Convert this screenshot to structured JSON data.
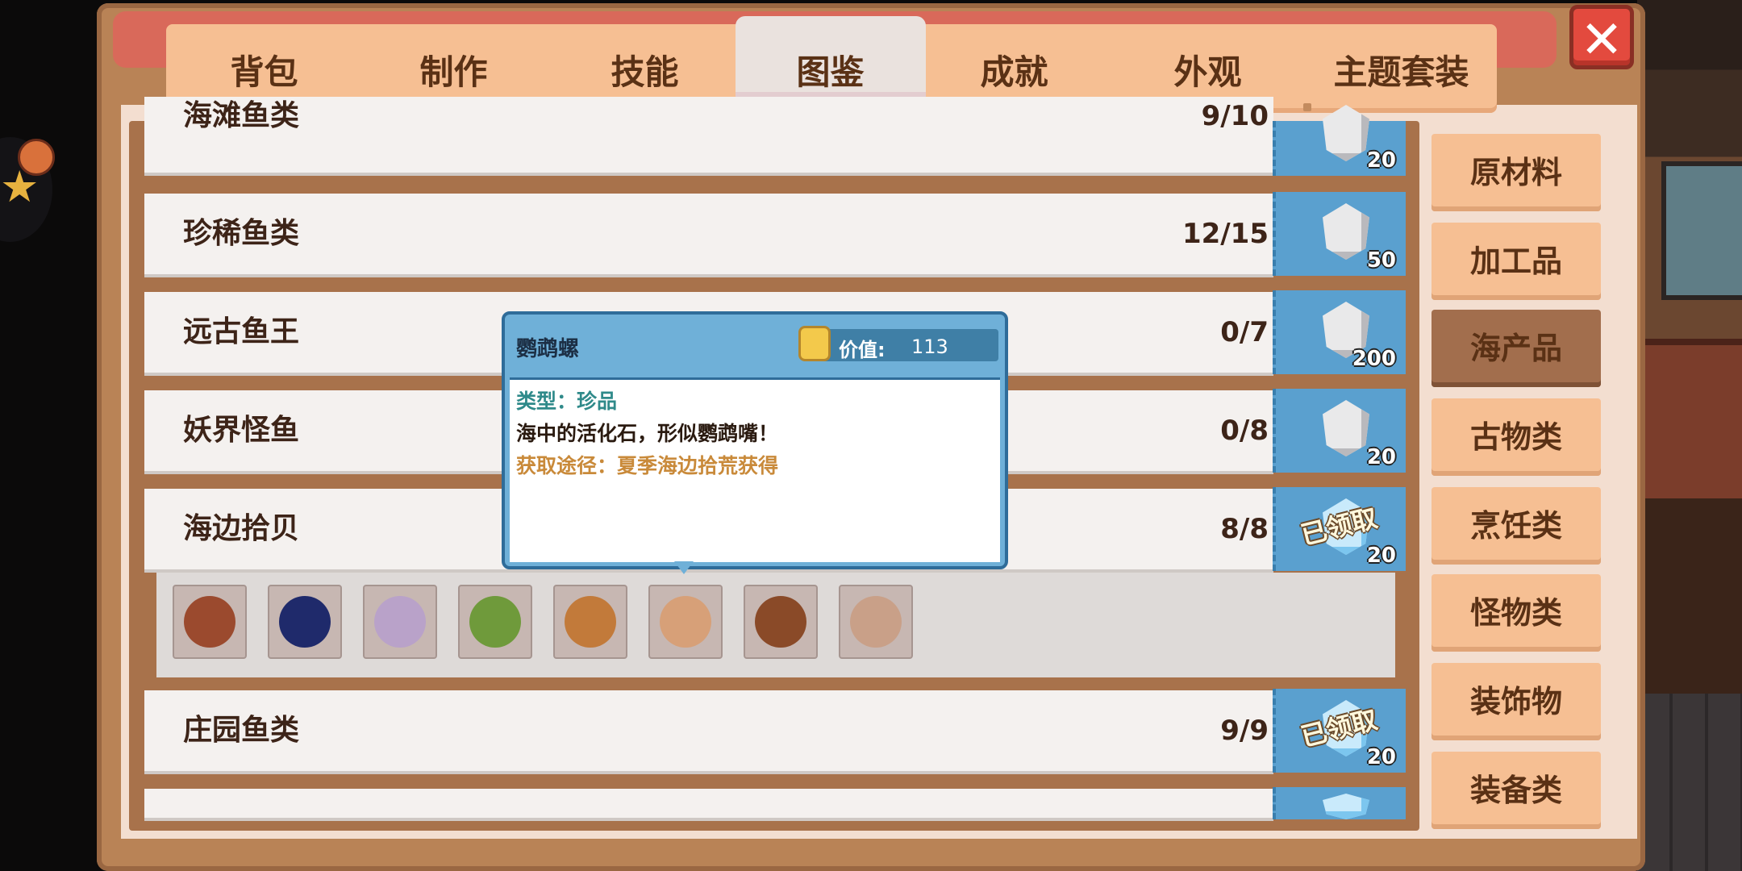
{
  "tabs": [
    "背包",
    "制作",
    "技能",
    "图鉴",
    "成就",
    "外观",
    "主题套装"
  ],
  "active_tab": "图鉴",
  "close_label": "✕",
  "collection_rows": [
    {
      "name": "海滩鱼类",
      "count": "9/10",
      "reward": "20",
      "claimed": false
    },
    {
      "name": "珍稀鱼类",
      "count": "12/15",
      "reward": "50",
      "claimed": false
    },
    {
      "name": "远古鱼王",
      "count": "0/7",
      "reward": "200",
      "claimed": false
    },
    {
      "name": "妖界怪鱼",
      "count": "0/8",
      "reward": "20",
      "claimed": false
    },
    {
      "name": "海边拾贝",
      "count": "8/8",
      "reward": "20",
      "claimed": true
    },
    {
      "name": "庄园鱼类",
      "count": "9/9",
      "reward": "20",
      "claimed": true
    }
  ],
  "claimed_label": "已领取",
  "categories": [
    "原材料",
    "加工品",
    "海产品",
    "古物类",
    "烹饪类",
    "怪物类",
    "装饰物",
    "装备类"
  ],
  "active_category": "海产品",
  "tooltip": {
    "title": "鹦鹉螺",
    "value_label": "价值:",
    "value": "113",
    "type": "类型：珍品",
    "description": "海中的活化石，形似鹦鹉嘴！",
    "source": "获取途径：夏季海边拾荒获得"
  },
  "item_icons": [
    "shell-spiral-icon",
    "sea-urchin-icon",
    "pearl-shell-icon",
    "green-leaf-shell-icon",
    "nautilus-icon",
    "scallop-icon",
    "conch-icon",
    "coral-icon"
  ],
  "colors": {
    "tab_bg": "#f6bf93",
    "active_category": "#a26e4d",
    "reward_bg": "#5aa0cf",
    "tooltip_header": "#6fb0d8"
  }
}
